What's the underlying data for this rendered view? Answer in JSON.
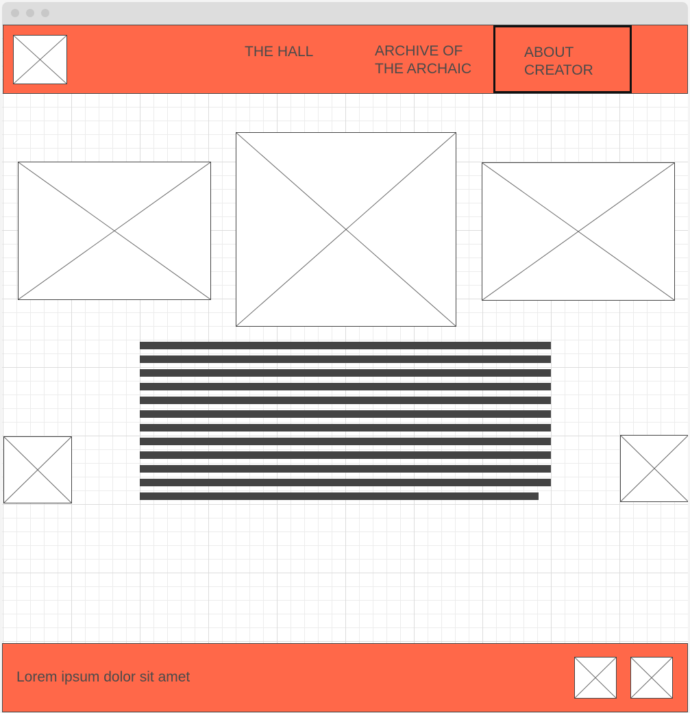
{
  "window": {
    "controls": [
      "close-dot",
      "minimize-dot",
      "maximize-dot"
    ]
  },
  "header": {
    "logo": "image-placeholder",
    "nav": [
      {
        "label": "THE HALL",
        "active": false
      },
      {
        "label": "ARCHIVE OF THE ARCHAIC",
        "line1": "ARCHIVE OF",
        "line2": "THE ARCHAIC",
        "active": false
      },
      {
        "label": "ABOUT CREATOR",
        "line1": "ABOUT",
        "line2": "CREATOR",
        "active": true
      }
    ]
  },
  "main": {
    "gallery": [
      "image-placeholder-left",
      "image-placeholder-center",
      "image-placeholder-right"
    ],
    "text_block": {
      "type": "placeholder-text-lines",
      "line_count": 12,
      "last_line_fraction": 0.97
    },
    "side_images": [
      "image-placeholder-left-side",
      "image-placeholder-right-side"
    ]
  },
  "footer": {
    "text": "Lorem ipsum dolor sit amet",
    "icons": [
      "image-placeholder",
      "image-placeholder"
    ]
  },
  "colors": {
    "accent": "#ff6849",
    "text": "#4a4a4a",
    "placeholder_line": "#444444",
    "active_border": "#111111"
  }
}
